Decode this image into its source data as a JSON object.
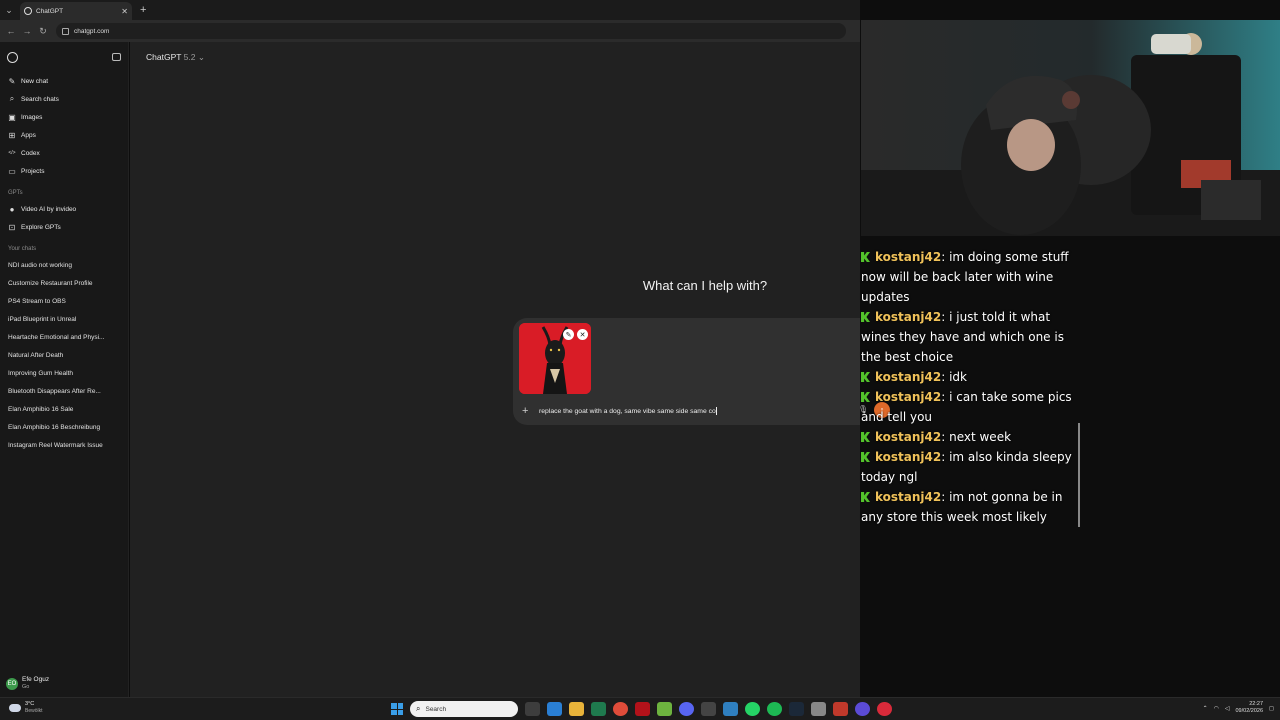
{
  "browser": {
    "tab_title": "ChatGPT",
    "url": "chatgpt.com"
  },
  "sidebar": {
    "main_items": [
      {
        "label": "New chat",
        "icon": "edit-icon"
      },
      {
        "label": "Search chats",
        "icon": "search-icon"
      },
      {
        "label": "Images",
        "icon": "image-icon"
      },
      {
        "label": "Apps",
        "icon": "apps-icon"
      },
      {
        "label": "Codex",
        "icon": "code-icon"
      },
      {
        "label": "Projects",
        "icon": "folder-icon"
      }
    ],
    "gpts_heading": "GPTs",
    "gpts": [
      {
        "label": "Video AI by invideo",
        "icon": "video-icon"
      },
      {
        "label": "Explore GPTs",
        "icon": "grid-icon"
      }
    ],
    "chats_heading": "Your chats",
    "chats": [
      "NDI audio not working",
      "Customize Restaurant Profile",
      "PS4 Stream to OBS",
      "iPad Blueprint in Unreal",
      "Heartache Emotional and Physi...",
      "Natural After Death",
      "Improving Gum Health",
      "Bluetooth Disappears After Re...",
      "Elan Amphibio 16 Sale",
      "Elan Amphibio 16 Beschreibung",
      "Instagram Reel Watermark Issue"
    ],
    "user": {
      "initials": "EO",
      "name": "Efe Oguz",
      "plan": "Go"
    }
  },
  "main": {
    "model_name": "ChatGPT",
    "model_version": "5.2",
    "hero_text": "What can I help with?",
    "prompt_text": "replace the goat with a dog, same vibe same side same co"
  },
  "stream_chat": [
    {
      "user": "kostanj42",
      "text": "im doing some stuff now will be back later with wine updates"
    },
    {
      "user": "kostanj42",
      "text": "i just told it what wines they have and which one is the best choice"
    },
    {
      "user": "kostanj42",
      "text": "idk"
    },
    {
      "user": "kostanj42",
      "text": "i can take some pics and tell you"
    },
    {
      "user": "kostanj42",
      "text": "next week"
    },
    {
      "user": "kostanj42",
      "text": "im also kinda sleepy today ngl"
    },
    {
      "user": "kostanj42",
      "text": "im not gonna be in any store this week most likely"
    }
  ],
  "taskbar": {
    "weather_temp": "3°C",
    "weather_cond": "Bewölkt",
    "search_placeholder": "Search",
    "time": "22:27",
    "date": "09/02/2026"
  },
  "colors": {
    "accent_send": "#e06a2a",
    "thumb_bg": "#d91c26",
    "chat_username": "#f0c25a"
  }
}
